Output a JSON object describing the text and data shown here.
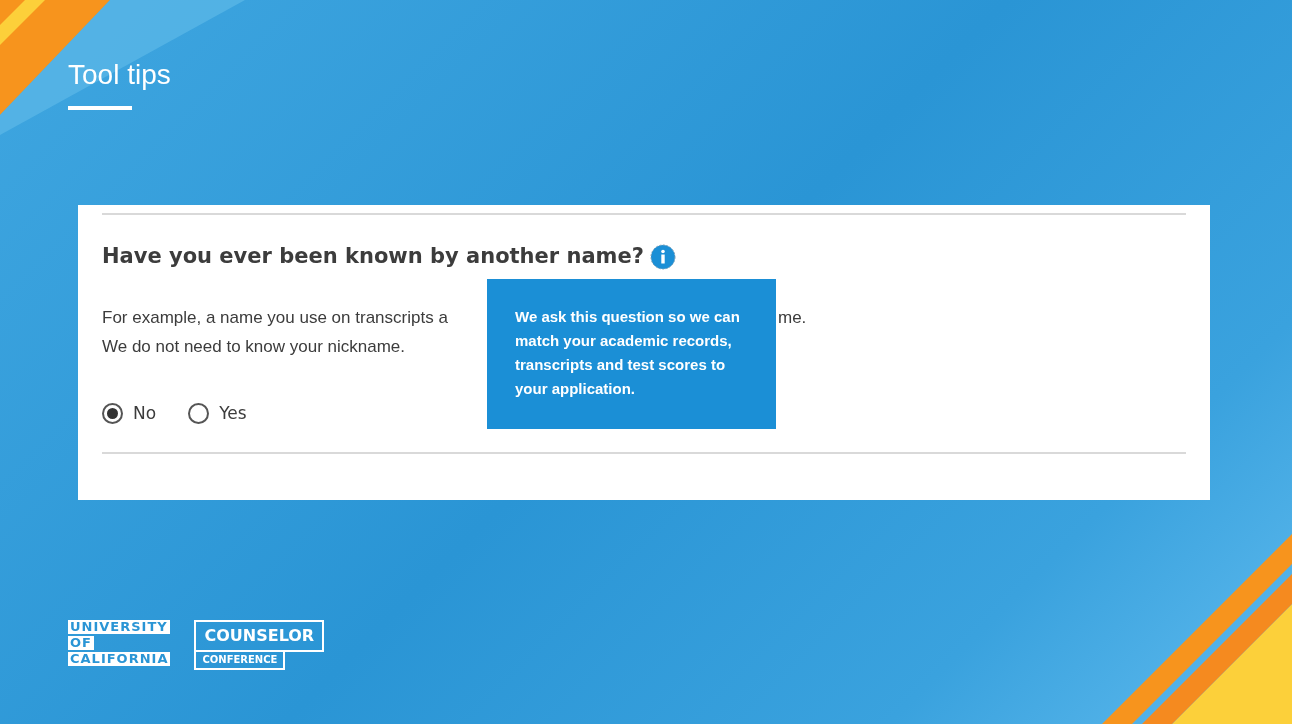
{
  "slide_title": "Tool tips",
  "form": {
    "question": "Have you ever been known by another name?",
    "help_line_1_start": "For example, a name you use on transcripts a",
    "help_line_1_end": "me.",
    "help_line_2": "We do not need to know your nickname.",
    "options": [
      {
        "label": "No",
        "selected": true
      },
      {
        "label": "Yes",
        "selected": false
      }
    ],
    "tooltip": "We ask this question so we can match your academic records, transcripts and test scores to your application."
  },
  "logos": {
    "university": [
      "UNIVERSITY",
      "OF",
      "CALIFORNIA"
    ],
    "badge_top": "COUNSELOR",
    "badge_bottom": "CONFERENCE"
  }
}
